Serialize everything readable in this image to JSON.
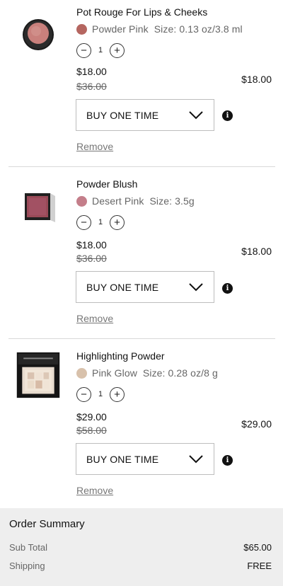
{
  "items": [
    {
      "name": "Pot Rouge For Lips & Cheeks",
      "shade": "Powder Pink",
      "shade_color": "#b56660",
      "size_label": "Size:",
      "size": "0.13 oz/3.8 ml",
      "qty": "1",
      "price": "$18.00",
      "original_price": "$36.00",
      "line_total": "$18.00",
      "purchase_option": "BUY ONE TIME",
      "remove_label": "Remove",
      "thumb_icon": "pot-rouge-compact-icon"
    },
    {
      "name": "Powder Blush",
      "shade": "Desert Pink",
      "shade_color": "#c47e8a",
      "size_label": "Size:",
      "size": "3.5g",
      "qty": "1",
      "price": "$18.00",
      "original_price": "$36.00",
      "line_total": "$18.00",
      "purchase_option": "BUY ONE TIME",
      "remove_label": "Remove",
      "thumb_icon": "powder-blush-compact-icon"
    },
    {
      "name": "Highlighting Powder",
      "shade": "Pink Glow",
      "shade_color": "#d8c1ab",
      "size_label": "Size:",
      "size": "0.28 oz/8 g",
      "qty": "1",
      "price": "$29.00",
      "original_price": "$58.00",
      "line_total": "$29.00",
      "purchase_option": "BUY ONE TIME",
      "remove_label": "Remove",
      "thumb_icon": "highlighting-powder-compact-icon"
    }
  ],
  "icons": {
    "minus": "−",
    "plus": "+",
    "chevron": "chevron-down-icon",
    "info": "i"
  },
  "summary": {
    "title": "Order Summary",
    "subtotal_label": "Sub Total",
    "subtotal_value": "$65.00",
    "shipping_label": "Shipping",
    "shipping_value": "FREE"
  }
}
